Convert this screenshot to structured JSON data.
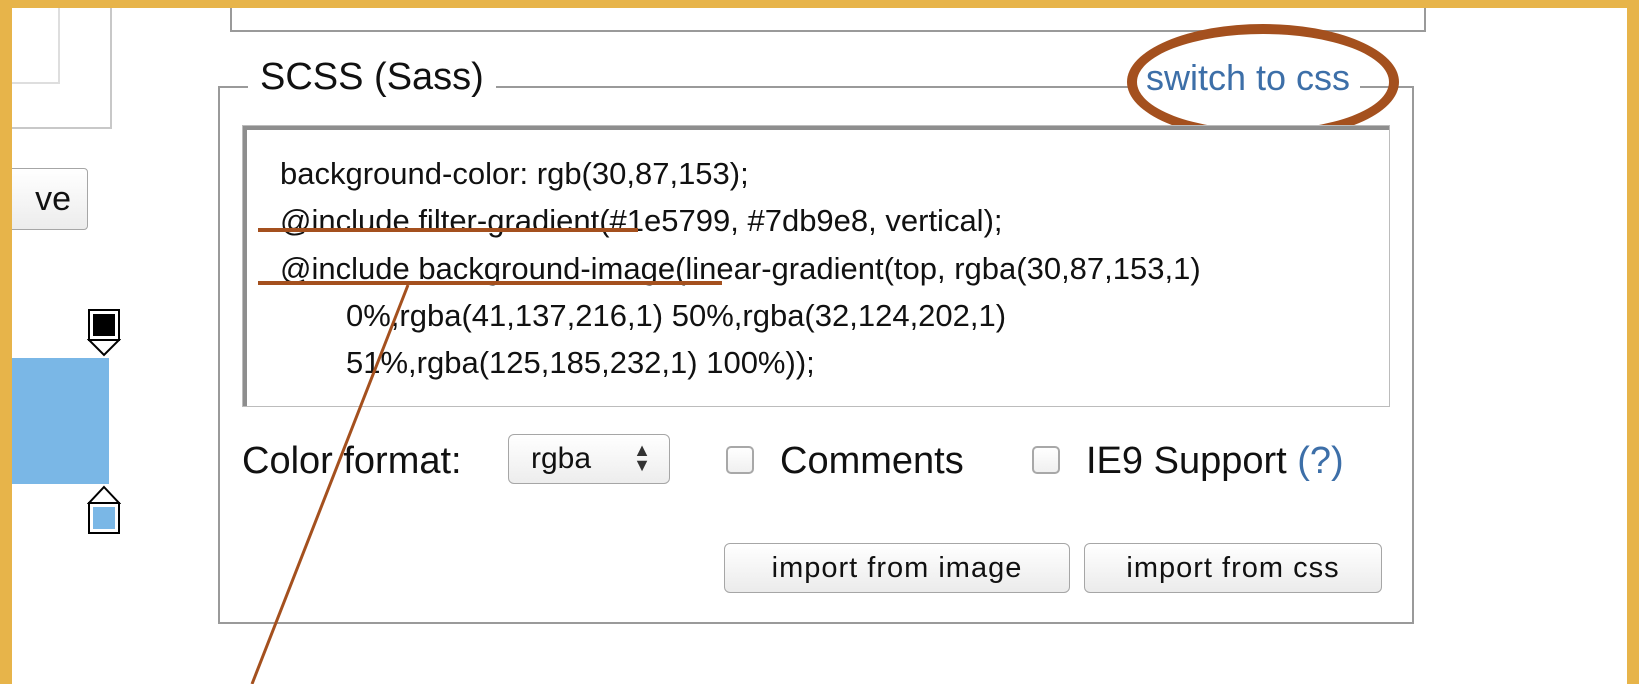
{
  "left_panel": {
    "save_button_label": "ve",
    "swatch_color": "#7ab7e6",
    "stop_top_color": "#000000",
    "stop_bottom_color": "#7ab7e6"
  },
  "scss_panel": {
    "legend": "SCSS (Sass)",
    "switch_link": "switch to css",
    "code_lines": [
      "background-color: rgb(30,87,153);",
      "@include filter-gradient(#1e5799, #7db9e8, vertical);",
      "@include background-image(linear-gradient(top, rgba(30,87,153,1)",
      "0%,rgba(41,137,216,1) 50%,rgba(32,124,202,1)",
      "51%,rgba(125,185,232,1) 100%));"
    ],
    "color_format_label": "Color format:",
    "color_format_value": "rgba",
    "comments_label": "Comments",
    "ie9_label": "IE9 Support",
    "ie9_help": "(?)",
    "import_image_label": "import from image",
    "import_css_label": "import from css"
  },
  "annotation_color": "#a4501e",
  "link_color": "#3d6fa8",
  "page_background": "#e7b44a"
}
